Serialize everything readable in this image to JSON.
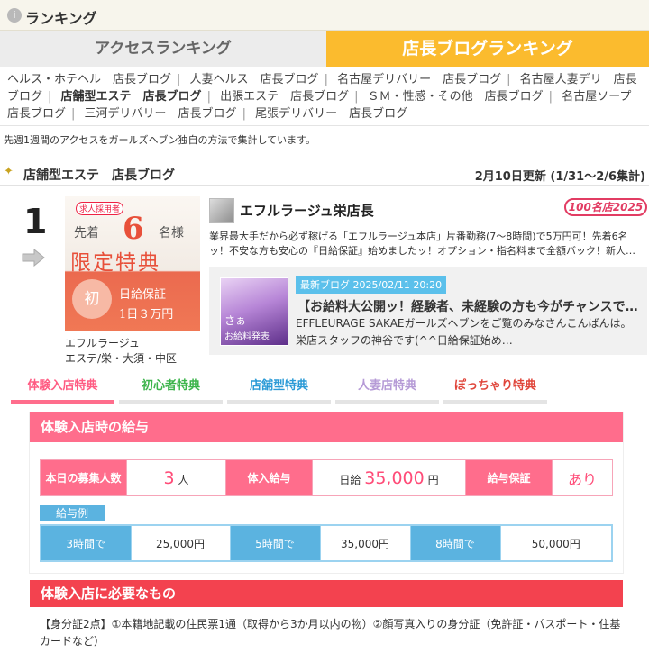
{
  "header": {
    "icon": "info-circle-icon",
    "title": "ランキング"
  },
  "tabs": [
    {
      "label": "アクセスランキング",
      "active": false
    },
    {
      "label": "店長ブログランキング",
      "active": true
    }
  ],
  "categories": [
    "ヘルス・ホテヘル　店長ブログ",
    "人妻ヘルス　店長ブログ",
    "名古屋デリバリー　店長ブログ",
    "名古屋人妻デリ　店長ブログ",
    "店舗型エステ　店長ブログ",
    "出張エステ　店長ブログ",
    "ＳＭ・性感・その他　店長ブログ",
    "名古屋ソープ　店長ブログ",
    "三河デリバリー　店長ブログ",
    "尾張デリバリー　店長ブログ"
  ],
  "note": "先週1週間のアクセスをガールズヘブン独自の方法で集計しています。",
  "section": {
    "title": "店舗型エステ　店長ブログ",
    "updated": "2月10日更新 (1/31～2/6集計)"
  },
  "entry": {
    "rank": "1",
    "banner": {
      "tag": "求人採用者",
      "line1": "先着",
      "num": "6",
      "line1b": "名様",
      "line2": "限定特典",
      "circle": "初",
      "line3": "日給保証",
      "line4": "1日３万円"
    },
    "shop_name": "エフルラージュ",
    "shop_area": "エステ/栄・大須・中区",
    "store_title": "エフルラージュ栄店長",
    "badge": "100名店2025",
    "description": "業界最大手だから必ず稼げる「エフルラージュ本店」片番勤務(7～8時間)で5万円可！先着6名ッ！不安な方も安心の『日給保証』始めましたッ！オプション・指名料まで全額バック！新人…",
    "blog": {
      "image_text": "さぁ",
      "image_sub": "お給料発表",
      "tag": "最新ブログ 2025/02/11 20:20",
      "title": "【お給料大公開ッ！経験者、未経験の方も今がチャンスで…",
      "text": "EFFLEURAGE SAKAEガールズヘブンをご覧のみなさんこんばんは。栄店スタッフの神谷です(^^日給保証始め…"
    }
  },
  "perk_tabs": [
    {
      "label": "体験入店特典",
      "color": "#ff5c83",
      "bar": "#ff6d8c"
    },
    {
      "label": "初心者特典",
      "color": "#3cb44b",
      "bar": "#e4e4e4"
    },
    {
      "label": "店舗型特典",
      "color": "#2a9ad6",
      "bar": "#e4e4e4"
    },
    {
      "label": "人妻店特典",
      "color": "#b59ad6",
      "bar": "#e4e4e4"
    },
    {
      "label": "ぽっちゃり特典",
      "color": "#e0453a",
      "bar": "#e4e4e4"
    }
  ],
  "pay": {
    "title": "体験入店時の給与",
    "recruit_label": "本日の募集人数",
    "recruit_num": "3",
    "recruit_unit": "人",
    "trial_label": "体入給与",
    "trial_prefix": "日給",
    "trial_amount": "35,000",
    "trial_unit": "円",
    "guarantee_label": "給与保証",
    "guarantee_value": "あり",
    "example_label": "給与例",
    "examples": [
      {
        "label": "3時間で",
        "value": "25,000円"
      },
      {
        "label": "5時間で",
        "value": "35,000円"
      },
      {
        "label": "8時間で",
        "value": "50,000円"
      }
    ]
  },
  "requirements": {
    "title": "体験入店に必要なもの",
    "text": "【身分証2点】①本籍地記載の住民票1通（取得から3か月以内の物）②顔写真入りの身分証（免許証・パスポート・住基カードなど）"
  }
}
